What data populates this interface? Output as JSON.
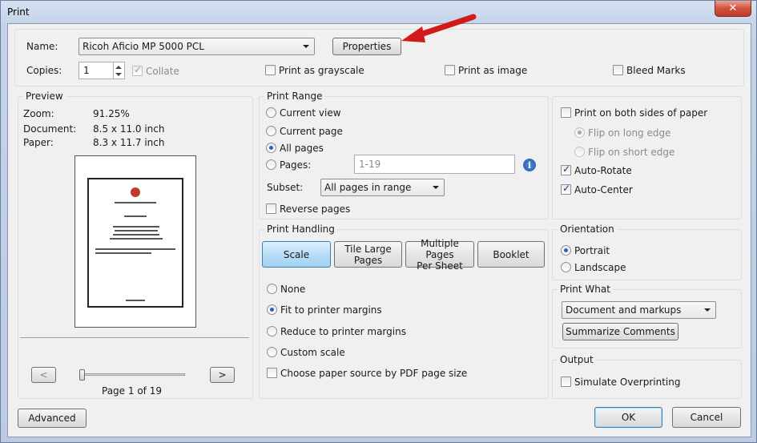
{
  "window": {
    "title": "Print",
    "close_label": "✕"
  },
  "printer": {
    "name_label": "Name:",
    "name_value": "Ricoh Aficio MP 5000 PCL",
    "properties_label": "Properties",
    "copies_label": "Copies:",
    "copies_value": "1",
    "collate_label": "Collate",
    "grayscale_label": "Print as grayscale",
    "image_label": "Print as image",
    "bleed_label": "Bleed Marks"
  },
  "preview": {
    "title": "Preview",
    "zoom_label": "Zoom:",
    "zoom_value": "91.25%",
    "document_label": "Document:",
    "document_value": "8.5 x 11.0 inch",
    "paper_label": "Paper:",
    "paper_value": "8.3 x 11.7 inch",
    "prev_label": "<",
    "next_label": ">",
    "page_status": "Page 1 of 19"
  },
  "print_range": {
    "title": "Print Range",
    "current_view": "Current view",
    "current_page": "Current page",
    "all_pages": "All pages",
    "pages_label": "Pages:",
    "pages_value": "1-19",
    "subset_label": "Subset:",
    "subset_value": "All pages in range",
    "reverse_label": "Reverse pages"
  },
  "print_handling": {
    "title": "Print Handling",
    "tab_scale": "Scale",
    "tab_tile_1": "Tile Large",
    "tab_tile_2": "Pages",
    "tab_multi_1": "Multiple Pages",
    "tab_multi_2": "Per Sheet",
    "tab_booklet": "Booklet",
    "opt_none": "None",
    "opt_fit": "Fit to printer margins",
    "opt_reduce": "Reduce to printer margins",
    "opt_custom": "Custom scale",
    "paper_source": "Choose paper source by PDF page size"
  },
  "duplex": {
    "both_sides": "Print on both sides of paper",
    "flip_long": "Flip on long edge",
    "flip_short": "Flip on short edge",
    "auto_rotate": "Auto-Rotate",
    "auto_center": "Auto-Center"
  },
  "orientation": {
    "title": "Orientation",
    "portrait": "Portrait",
    "landscape": "Landscape"
  },
  "print_what": {
    "title": "Print What",
    "value": "Document and markups",
    "summarize_label": "Summarize Comments"
  },
  "output": {
    "title": "Output",
    "simulate_label": "Simulate Overprinting"
  },
  "footer": {
    "advanced_label": "Advanced",
    "ok_label": "OK",
    "cancel_label": "Cancel"
  },
  "colors": {
    "accent": "#3c7fb1",
    "close": "#c0392b"
  }
}
